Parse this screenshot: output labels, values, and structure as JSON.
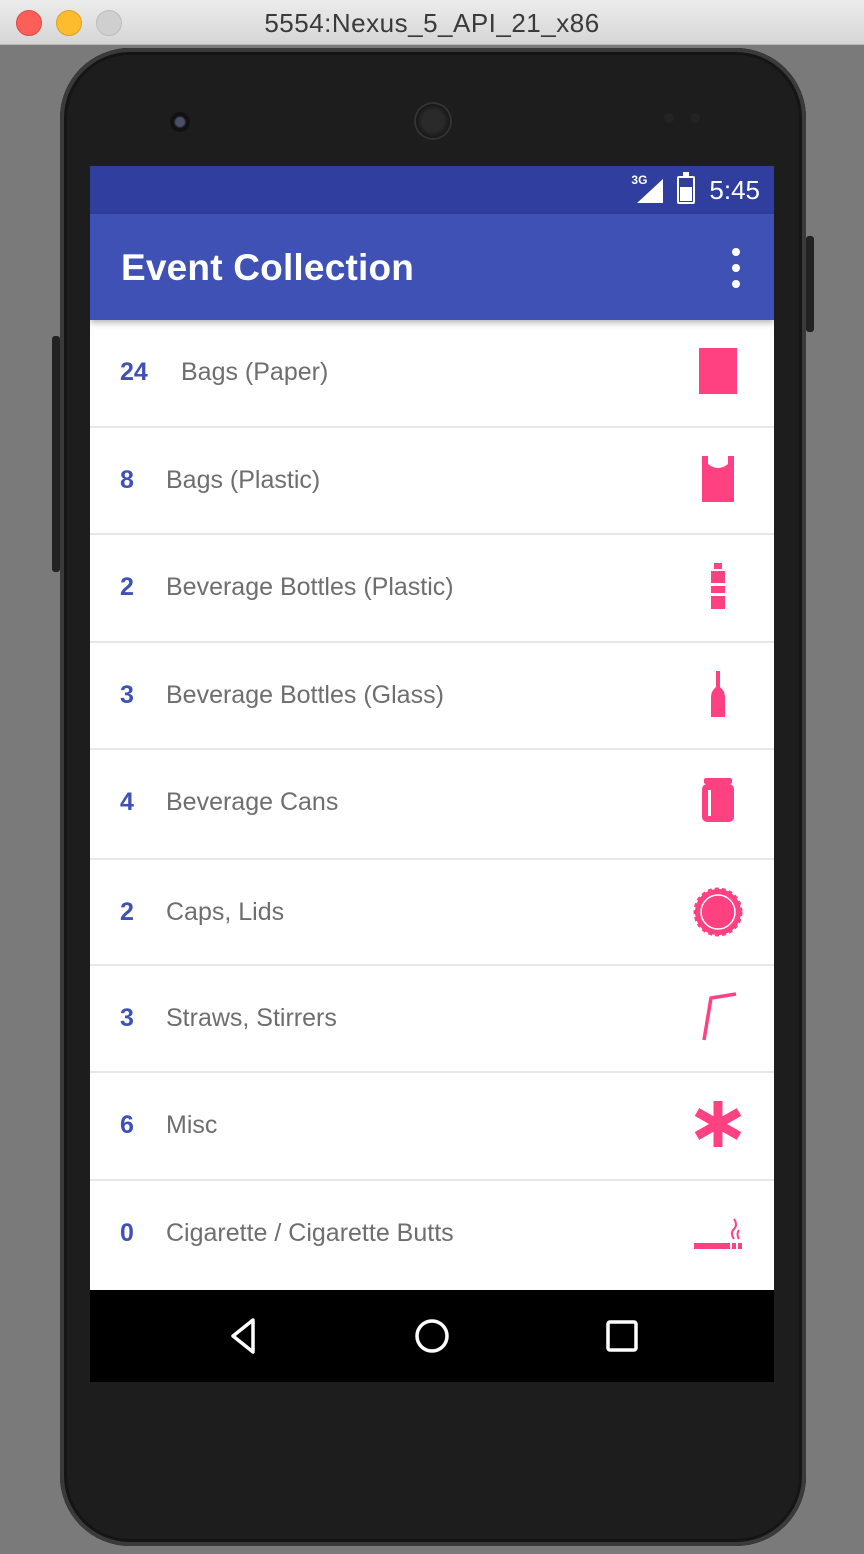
{
  "window": {
    "title": "5554:Nexus_5_API_21_x86"
  },
  "status_bar": {
    "network": "3G",
    "time": "5:45"
  },
  "app_bar": {
    "title": "Event Collection"
  },
  "items": [
    {
      "count": "24",
      "label": "Bags (Paper)",
      "icon": "paper-bag-icon"
    },
    {
      "count": "8",
      "label": "Bags (Plastic)",
      "icon": "plastic-bag-icon"
    },
    {
      "count": "2",
      "label": "Beverage Bottles (Plastic)",
      "icon": "plastic-bottle-icon"
    },
    {
      "count": "3",
      "label": "Beverage Bottles (Glass)",
      "icon": "glass-bottle-icon"
    },
    {
      "count": "4",
      "label": "Beverage Cans",
      "icon": "can-icon"
    },
    {
      "count": "2",
      "label": "Caps, Lids",
      "icon": "bottle-cap-icon"
    },
    {
      "count": "3",
      "label": "Straws, Stirrers",
      "icon": "straw-icon"
    },
    {
      "count": "6",
      "label": "Misc",
      "icon": "asterisk-icon"
    },
    {
      "count": "0",
      "label": "Cigarette / Cigarette Butts",
      "icon": "cigarette-icon"
    }
  ],
  "colors": {
    "primary": "#3f51b5",
    "primary_dark": "#303f9f",
    "accent": "#ff4081",
    "item_text": "#6e6e6e"
  }
}
